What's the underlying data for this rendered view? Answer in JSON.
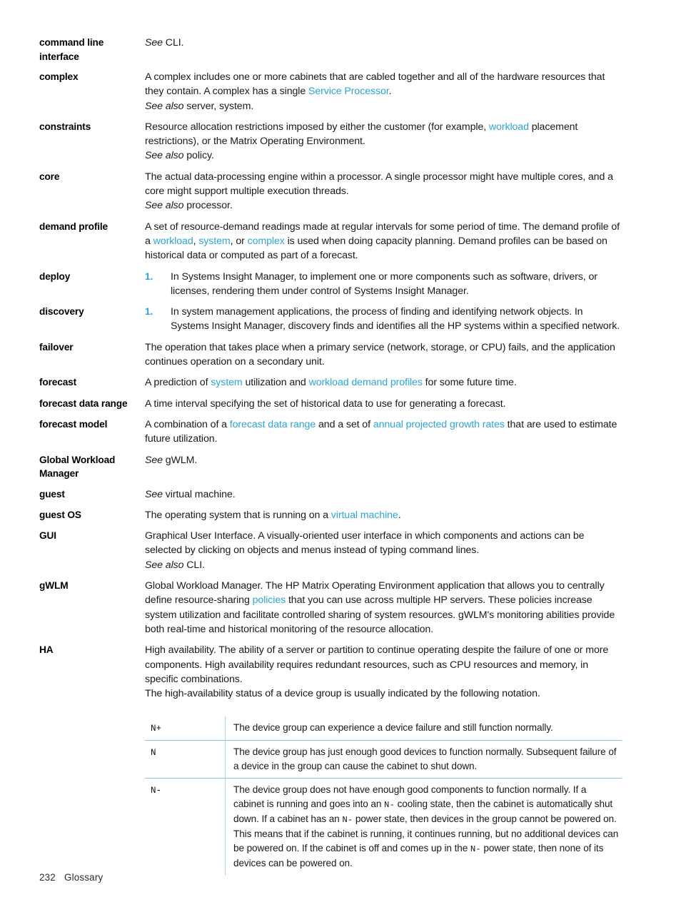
{
  "page": {
    "footer_page_number": "232",
    "footer_section": "Glossary",
    "link_color": "#2BA5DE",
    "rule_color": "#7FC6E8"
  },
  "entries": [
    {
      "term": "command line interface",
      "blocks": [
        {
          "kind": "see",
          "lead": "See",
          "text": " CLI."
        }
      ]
    },
    {
      "term": "complex",
      "blocks": [
        {
          "kind": "rich",
          "text": "A complex includes one or more cabinets that are cabled together and all of the hardware resources that they contain. A complex has a single ",
          "link": "Service Processor",
          "tail": "."
        },
        {
          "kind": "see",
          "lead": "See also",
          "text": " server, system."
        }
      ]
    },
    {
      "term": "constraints",
      "blocks": [
        {
          "kind": "rich",
          "text": "Resource allocation restrictions imposed by either the customer (for example, ",
          "link": "workload",
          "tail": " placement restrictions), or the Matrix Operating Environment."
        },
        {
          "kind": "see",
          "lead": "See also",
          "text": " policy."
        }
      ]
    },
    {
      "term": "core",
      "blocks": [
        {
          "kind": "plain",
          "text": "The actual data-processing engine within a processor. A single processor might have multiple cores, and a core might support multiple execution threads."
        },
        {
          "kind": "see",
          "lead": "See also",
          "text": " processor."
        }
      ]
    },
    {
      "term": "demand profile",
      "blocks": [
        {
          "kind": "demand",
          "text": "A set of resource-demand readings made at regular intervals for some period of time. The demand profile of a "
        }
      ]
    },
    {
      "term": "deploy",
      "blocks": [
        {
          "kind": "num",
          "marker": "1.",
          "text": "In Systems Insight Manager, to implement one or more components such as software, drivers, or licenses, rendering them under control of Systems Insight Manager."
        }
      ]
    },
    {
      "term": "discovery",
      "blocks": [
        {
          "kind": "num",
          "marker": "1.",
          "text": "In system management applications, the process of finding and identifying network objects. In Systems Insight Manager, discovery finds and identifies all the HP systems within a specified network."
        }
      ]
    },
    {
      "term": "failover",
      "blocks": [
        {
          "kind": "plain",
          "text": "The operation that takes place when a primary service (network, storage, or CPU) fails, and the application continues operation on a secondary unit."
        }
      ]
    },
    {
      "term": "forecast",
      "blocks": [
        {
          "kind": "forecast",
          "text": "A prediction of "
        }
      ]
    },
    {
      "term": "forecast data range",
      "blocks": [
        {
          "kind": "plain",
          "text": "A time interval specifying the set of historical data to use for generating a forecast."
        }
      ]
    },
    {
      "term": "forecast model",
      "blocks": [
        {
          "kind": "fmodel",
          "text": "A combination of a "
        }
      ]
    },
    {
      "term": "Global Workload Manager",
      "blocks": [
        {
          "kind": "see",
          "lead": "See",
          "text": " gWLM."
        }
      ]
    },
    {
      "term": "guest",
      "blocks": [
        {
          "kind": "see",
          "lead": "See",
          "text": " virtual machine."
        }
      ]
    },
    {
      "term": "guest OS",
      "blocks": [
        {
          "kind": "rich",
          "text": "The operating system that is running on a ",
          "link": "virtual machine",
          "tail": "."
        }
      ]
    },
    {
      "term": "GUI",
      "blocks": [
        {
          "kind": "plain",
          "text": "Graphical User Interface. A visually-oriented user interface in which components and actions can be selected by clicking on objects and menus instead of typing command lines."
        },
        {
          "kind": "see",
          "lead": "See also",
          "text": " CLI."
        }
      ]
    },
    {
      "term": "gWLM",
      "blocks": [
        {
          "kind": "rich",
          "text": "Global Workload Manager. The HP Matrix Operating Environment application that allows you to centrally define resource-sharing ",
          "link": "policies",
          "tail": " that you can use across multiple HP servers. These policies increase system utilization and facilitate controlled sharing of system resources. gWLM's monitoring abilities provide both real-time and historical monitoring of the resource allocation."
        }
      ]
    },
    {
      "term": "HA",
      "blocks": [
        {
          "kind": "plain",
          "text": "High availability. The ability of a server or partition to continue operating despite the failure of one or more components. High availability requires redundant resources, such as CPU resources and memory, in specific combinations."
        },
        {
          "kind": "plain",
          "text": "The high-availability status of a device group is usually indicated by the following notation."
        }
      ]
    }
  ],
  "inline_links": {
    "demand_profile": {
      "link1": "workload",
      "sep1": ", ",
      "link2": "system",
      "sep2": ", or ",
      "link3": "complex",
      "tail": " is used when doing capacity planning. Demand profiles can be based on historical data or computed as part of a forecast."
    },
    "forecast": {
      "link1": "system",
      "sep1": " utilization and ",
      "link2": "workload demand profiles",
      "tail": " for some future time."
    },
    "forecast_model": {
      "link1": "forecast data range",
      "sep1": " and a set of ",
      "link2": "annual projected growth rates",
      "tail": " that are used to estimate future utilization."
    }
  },
  "notation_table": {
    "rows": [
      {
        "code": "N+",
        "description": "The device group can experience a device failure and still function normally."
      },
      {
        "code": "N",
        "description": "The device group has just enough good devices to function normally. Subsequent failure of a device in the group can cause the cabinet to shut down."
      },
      {
        "code": "N-",
        "description_parts": {
          "p1": "The device group does not have enough good components to function normally. If a cabinet is running and goes into an ",
          "code1": "N-",
          "p2": " cooling state, then the cabinet is automatically shut down. If a cabinet has an ",
          "code2": "N-",
          "p3": " power state, then devices in the group cannot be powered on. This means that if the cabinet is running, it continues running, but no additional devices can be powered on. If the cabinet is off and comes up in the ",
          "code3": "N-",
          "p4": " power state, then none of its devices can be powered on."
        }
      }
    ]
  }
}
